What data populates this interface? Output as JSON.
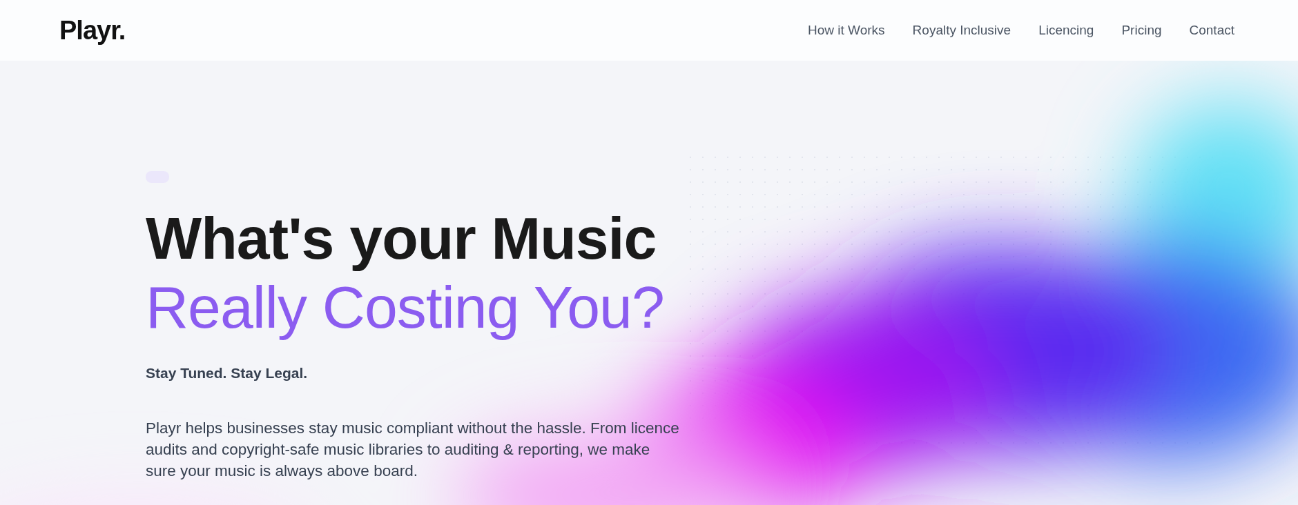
{
  "header": {
    "logo": "Playr.",
    "nav": [
      {
        "label": "How it Works"
      },
      {
        "label": "Royalty Inclusive"
      },
      {
        "label": "Licencing"
      },
      {
        "label": "Pricing"
      },
      {
        "label": "Contact"
      }
    ]
  },
  "hero": {
    "headline_line1": "What's your Music",
    "headline_line2": "Really Costing You?",
    "tagline": "Stay Tuned. Stay Legal.",
    "description": "Playr helps businesses stay music compliant without the hassle. From licence audits and copyright-safe music libraries to auditing & reporting, we make sure your music is always above board."
  }
}
